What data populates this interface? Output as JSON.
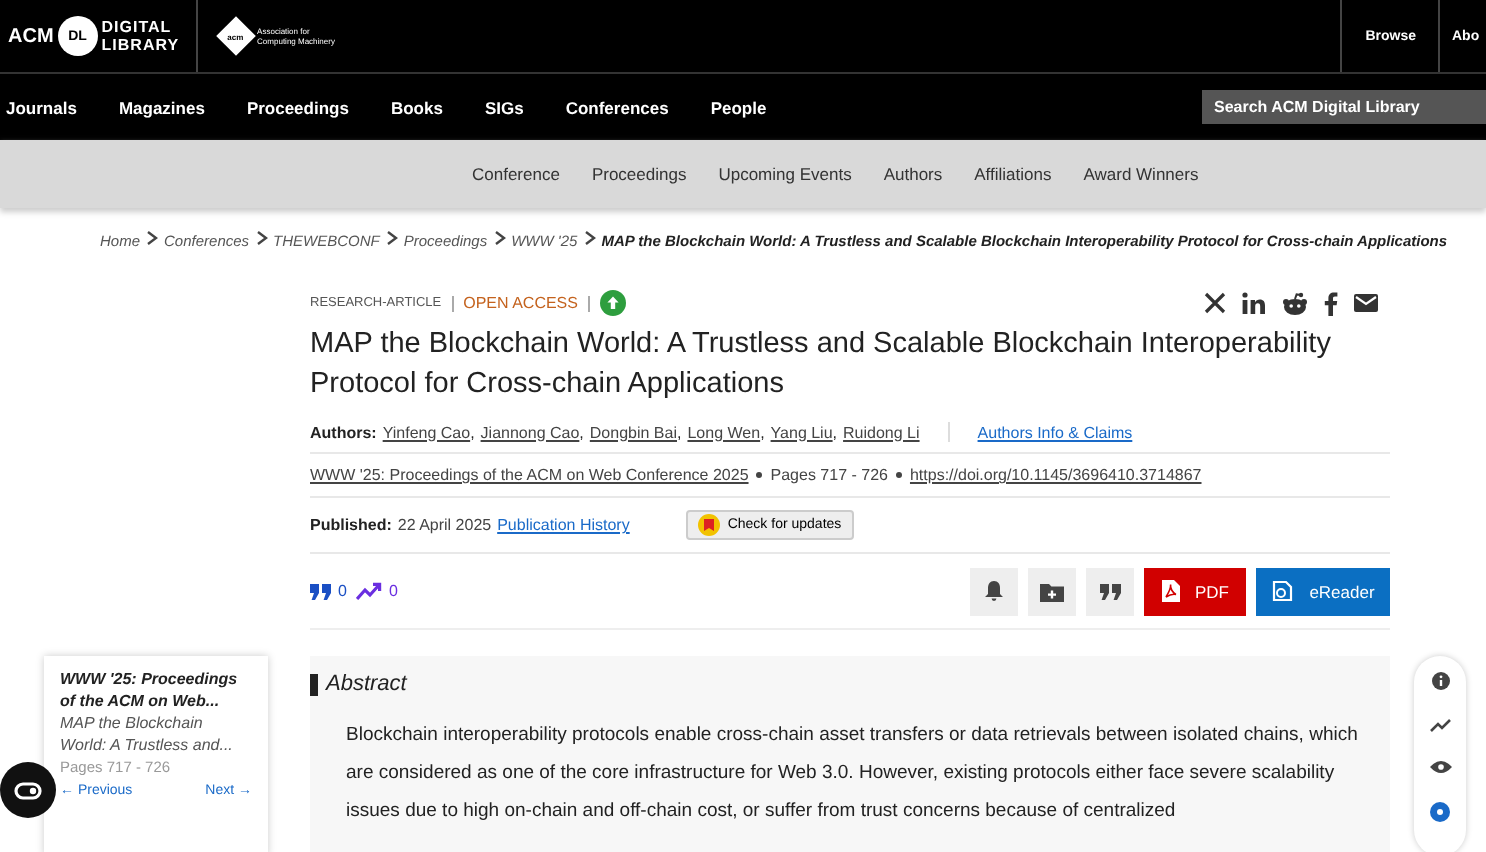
{
  "header": {
    "logo": {
      "left": "ACM",
      "badge": "DL",
      "right_lines": [
        "DIGITAL",
        "LIBRARY"
      ]
    },
    "association": {
      "emblem": "acm",
      "lines": [
        "Association for",
        "Computing Machinery"
      ]
    },
    "top_links": [
      "Browse",
      "Abo"
    ]
  },
  "nav": {
    "items": [
      "Journals",
      "Magazines",
      "Proceedings",
      "Books",
      "SIGs",
      "Conferences",
      "People"
    ],
    "search": {
      "placeholder": "Search ACM Digital Library"
    }
  },
  "subnav": [
    "Conference",
    "Proceedings",
    "Upcoming Events",
    "Authors",
    "Affiliations",
    "Award Winners"
  ],
  "breadcrumb": [
    "Home",
    "Conferences",
    "THEWEBCONF",
    "Proceedings",
    "WWW '25",
    "MAP the Blockchain World: A Trustless and Scalable Blockchain Interoperability Protocol for Cross-chain Applications"
  ],
  "article": {
    "type": "RESEARCH-ARTICLE",
    "open_access": "OPEN ACCESS",
    "title": "MAP the Blockchain World: A Trustless and Scalable Blockchain Interoperability Protocol for Cross-chain Applications",
    "authors_label": "Authors:",
    "author_separator": ",",
    "authors": [
      "Yinfeng Cao",
      "Jiannong Cao",
      "Dongbin Bai",
      "Long Wen",
      "Yang Liu",
      "Ruidong Li"
    ],
    "authors_info": "Authors Info & Claims",
    "proceedings": "WWW '25: Proceedings of the ACM on Web Conference 2025",
    "pages": "Pages 717 - 726",
    "doi": "https://doi.org/10.1145/3696410.3714867",
    "published_label": "Published:",
    "published_date": "22 April 2025",
    "history": "Publication History",
    "check_updates": "Check for updates"
  },
  "metrics": [
    {
      "kind": "citations",
      "value": "0"
    },
    {
      "kind": "downloads",
      "value": "0"
    }
  ],
  "actions": [
    {
      "kind": "bell"
    },
    {
      "kind": "folder"
    },
    {
      "kind": "quote"
    },
    {
      "kind": "pdf",
      "label": "PDF"
    },
    {
      "kind": "ereader",
      "label": "eReader"
    }
  ],
  "abstract": {
    "heading": "Abstract",
    "text": "Blockchain interoperability protocols enable cross-chain asset transfers or data retrievals between isolated chains, which are considered as one of the core infrastructure for Web 3.0. However, existing protocols either face severe scalability issues due to high on-chain and off-chain cost, or suffer from trust concerns because of centralized"
  },
  "sidebar_card": {
    "proceedings": "WWW '25: Proceedings of the ACM on Web...",
    "title": "MAP the Blockchain World: A Trustless and...",
    "pages": "Pages 717 - 726",
    "previous": "← Previous",
    "next": "Next →"
  },
  "side_tools": [
    {
      "kind": "info"
    },
    {
      "kind": "trend"
    },
    {
      "kind": "eye"
    },
    {
      "kind": "badge"
    }
  ]
}
